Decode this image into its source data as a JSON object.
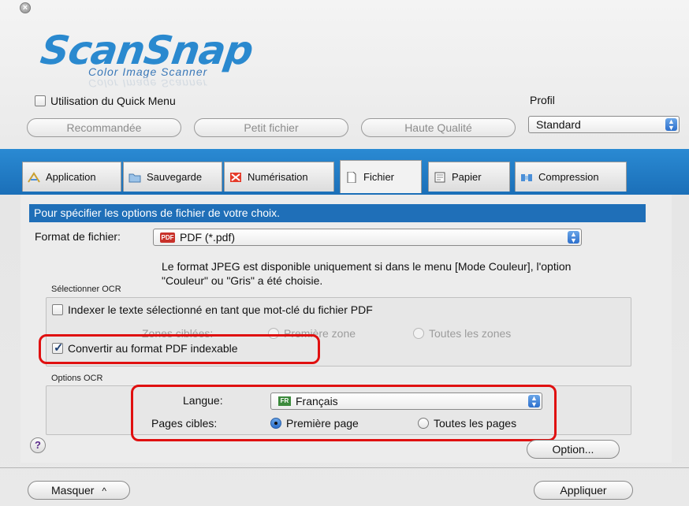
{
  "window": {
    "close_glyph": "×"
  },
  "logo": {
    "main": "ScanSnap",
    "sub": "Color Image Scanner"
  },
  "quick_menu": {
    "label": "Utilisation du Quick Menu",
    "checked": false
  },
  "profile": {
    "label": "Profil",
    "value": "Standard"
  },
  "presets": [
    "Recommandée",
    "Petit fichier",
    "Haute Qualité"
  ],
  "tabs": [
    {
      "label": "Application",
      "icon": "application-icon"
    },
    {
      "label": "Sauvegarde",
      "icon": "folder-icon"
    },
    {
      "label": "Numérisation",
      "icon": "scan-icon"
    },
    {
      "label": "Fichier",
      "icon": "file-icon",
      "active": true
    },
    {
      "label": "Papier",
      "icon": "paper-icon"
    },
    {
      "label": "Compression",
      "icon": "compression-icon"
    }
  ],
  "section": {
    "header": "Pour spécifier les options de fichier de votre choix."
  },
  "format": {
    "label": "Format de fichier:",
    "icon_text": "PDF",
    "value": "PDF (*.pdf)"
  },
  "note": "Le format JPEG est disponible uniquement si dans le menu [Mode Couleur], l'option \"Couleur\" ou \"Gris\" a été choisie.",
  "ocr_select": {
    "group_label": "Sélectionner OCR",
    "index_label": "Indexer le texte sélectionné en tant que mot-clé du fichier PDF",
    "index_checked": false,
    "zones_label": "Zones ciblées:",
    "zone_first": "Première zone",
    "zone_all": "Toutes les zones",
    "convert_label": "Convertir  au format PDF indexable",
    "convert_checked": true
  },
  "ocr_options": {
    "group_label": "Options OCR",
    "langue_label": "Langue:",
    "langue_icon_text": "FR",
    "langue_value": "Français",
    "pages_label": "Pages cibles:",
    "page_first": "Première page",
    "page_all": "Toutes les pages",
    "selected": "Première page"
  },
  "buttons": {
    "help": "?",
    "option": "Option...",
    "masquer": "Masquer",
    "masquer_arrow": "^",
    "appliquer": "Appliquer"
  },
  "colors": {
    "accent_blue": "#1f6fb8",
    "highlight_red": "#e01010"
  }
}
